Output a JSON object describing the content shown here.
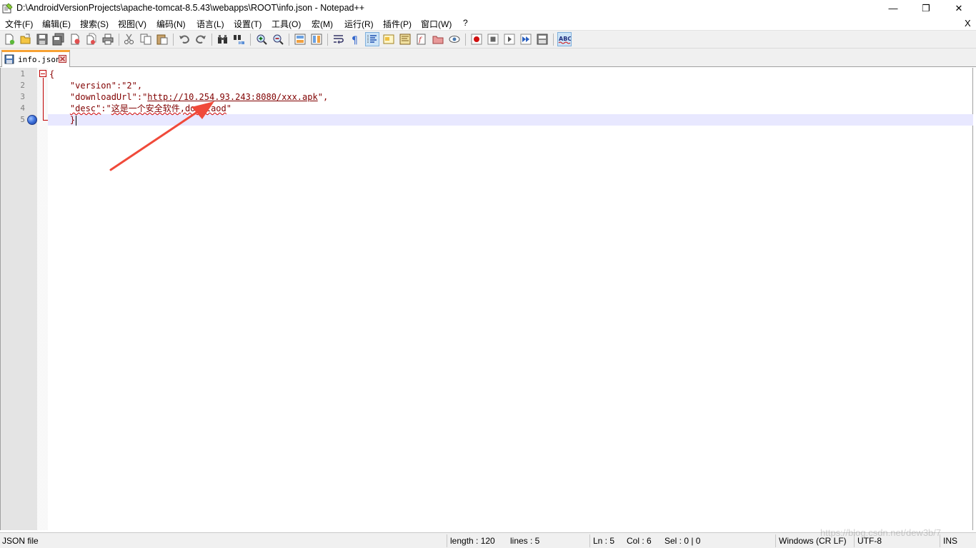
{
  "window": {
    "title": "D:\\AndroidVersionProjects\\apache-tomcat-8.5.43\\webapps\\ROOT\\info.json - Notepad++",
    "minimize_glyph": "—",
    "maximize_glyph": "❐",
    "close_glyph": "✕"
  },
  "menu": {
    "items": [
      "文件(F)",
      "编辑(E)",
      "搜索(S)",
      "视图(V)",
      "编码(N)",
      "语言(L)",
      "设置(T)",
      "工具(O)",
      "宏(M)",
      "运行(R)",
      "插件(P)",
      "窗口(W)",
      "?"
    ],
    "close_doc": "X"
  },
  "toolbar": {
    "icons": [
      "new-file-icon",
      "open-file-icon",
      "save-icon",
      "save-all-icon",
      "close-icon",
      "close-all-icon",
      "print-icon",
      "cut-icon",
      "copy-icon",
      "paste-icon",
      "undo-icon",
      "redo-icon",
      "find-icon",
      "replace-icon",
      "zoom-in-icon",
      "zoom-out-icon",
      "sync-vertical-icon",
      "sync-horizontal-icon",
      "word-wrap-icon",
      "show-all-chars-icon",
      "indent-guide-icon",
      "udl-icon",
      "doc-map-icon",
      "function-list-icon",
      "folder-workspace-icon",
      "monitoring-icon",
      "record-macro-icon",
      "stop-macro-icon",
      "play-macro-icon",
      "run-macro-multiple-icon",
      "save-macro-icon",
      "spell-check-icon"
    ]
  },
  "tabs": [
    {
      "label": "info.json",
      "modified": false
    }
  ],
  "editor": {
    "line_numbers": [
      "1",
      "2",
      "3",
      "4",
      "5"
    ],
    "lines": [
      {
        "parts": [
          {
            "t": "{",
            "c": "op"
          }
        ]
      },
      {
        "parts": [
          {
            "t": "    "
          },
          {
            "t": "\"version\"",
            "c": "key"
          },
          {
            "t": ":",
            "c": "op"
          },
          {
            "t": "\"2\"",
            "c": "str"
          },
          {
            "t": ",",
            "c": "op"
          }
        ]
      },
      {
        "parts": [
          {
            "t": "    "
          },
          {
            "t": "\"downloadUrl\"",
            "c": "key"
          },
          {
            "t": ":",
            "c": "op"
          },
          {
            "t": "\"",
            "c": "str"
          },
          {
            "t": "http://10.254.93.243:8080/xxx.apk",
            "c": "url"
          },
          {
            "t": "\"",
            "c": "str"
          },
          {
            "t": ",",
            "c": "op"
          }
        ]
      },
      {
        "parts": [
          {
            "t": "    "
          },
          {
            "t": "\"desc\"",
            "c": "key squiggle"
          },
          {
            "t": ":",
            "c": "op"
          },
          {
            "t": "\"",
            "c": "str"
          },
          {
            "t": "这是一个安全软件,downlaod",
            "c": "str squiggle"
          },
          {
            "t": "\"",
            "c": "str"
          }
        ]
      },
      {
        "parts": [
          {
            "t": "    "
          },
          {
            "t": "}",
            "c": "op"
          }
        ]
      }
    ],
    "accent_fold_color": "#c00000",
    "current_line_color": "#e8e8ff"
  },
  "annotation": {
    "arrow_color": "#f04a3a"
  },
  "statusbar": {
    "file_type": "JSON file",
    "length": "length : 120",
    "lines": "lines : 5",
    "ln": "Ln : 5",
    "col": "Col : 6",
    "sel": "Sel : 0 | 0",
    "eol": "Windows (CR LF)",
    "encoding": "UTF-8",
    "mode": "INS"
  },
  "watermark": "https://blog.csdn.net/dew3b/7"
}
